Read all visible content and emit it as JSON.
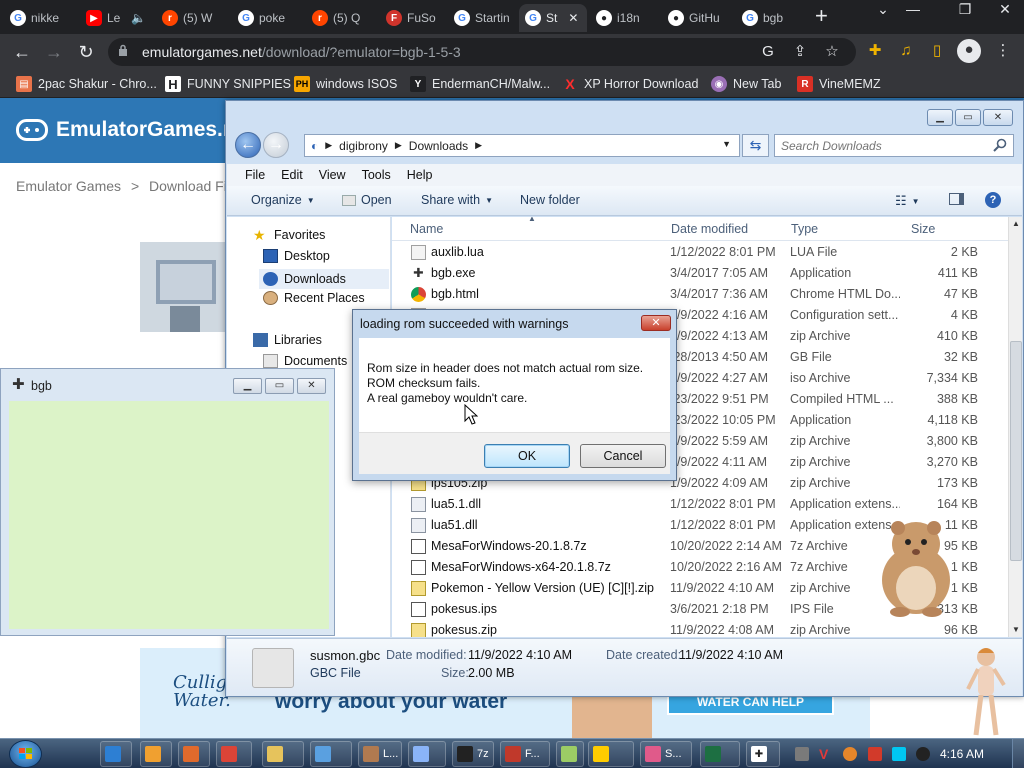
{
  "browser": {
    "tabs": [
      {
        "label": "nikke",
        "favicon": "google-icon",
        "color": "#4285f4"
      },
      {
        "label": "Le",
        "favicon": "youtube-icon",
        "color": "#ff0000"
      },
      {
        "label": "(5) W",
        "favicon": "reddit-icon",
        "color": "#ff4500"
      },
      {
        "label": "poke",
        "favicon": "google-icon",
        "color": "#4285f4"
      },
      {
        "label": "(5) Q",
        "favicon": "reddit-icon",
        "color": "#ff4500"
      },
      {
        "label": "FuSo",
        "favicon": "fuso-icon",
        "color": "#d0342c"
      },
      {
        "label": "Startin",
        "favicon": "google-icon",
        "color": "#4285f4"
      },
      {
        "label": "St",
        "favicon": "google-icon",
        "color": "#4285f4"
      },
      {
        "label": "i18n",
        "favicon": "github-icon",
        "color": "#ffffff"
      },
      {
        "label": "GitHu",
        "favicon": "github-icon",
        "color": "#ffffff"
      },
      {
        "label": "bgb",
        "favicon": "google-icon",
        "color": "#4285f4"
      }
    ],
    "url_host": "emulatorgames.net",
    "url_path": "/download/?emulator=bgb-1-5-3",
    "bookmarks": [
      {
        "label": "2pac Shakur - Chro...",
        "icon": "chrome-store-icon",
        "color": "#e8734a"
      },
      {
        "label": "FUNNY SNIPPIES",
        "icon": "h-icon",
        "color": "#202124",
        "glyph": "H"
      },
      {
        "label": "windows ISOS",
        "icon": "ph-icon",
        "color": "#f7a600",
        "glyph": "PH"
      },
      {
        "label": "EndermanCH/Malw...",
        "icon": "yp-icon",
        "color": "#202124",
        "glyph": "Y"
      },
      {
        "label": "XP Horror Download",
        "icon": "x-icon",
        "color": "#202124",
        "glyph": "X"
      },
      {
        "label": "New Tab",
        "icon": "newtab-icon",
        "color": "#9a6fb5"
      },
      {
        "label": "VineMEMZ",
        "icon": "vine-icon",
        "color": "#d93025",
        "glyph": "R"
      }
    ]
  },
  "website": {
    "logo": "EmulatorGames.ne",
    "breadcrumb_home": "Emulator Games",
    "breadcrumb_sep": ">",
    "breadcrumb_current": "Download Fil",
    "ad_brand": "Culligan",
    "ad_brand_line2": "Water.",
    "ad_text": "worry about your water",
    "ad_cta": "WATER CAN HELP"
  },
  "explorer": {
    "path": [
      "digibrony",
      "Downloads"
    ],
    "search_placeholder": "Search Downloads",
    "menu": [
      "File",
      "Edit",
      "View",
      "Tools",
      "Help"
    ],
    "commands": {
      "organize": "Organize",
      "open": "Open",
      "share": "Share with",
      "new_folder": "New folder"
    },
    "nav": {
      "favorites": "Favorites",
      "desktop": "Desktop",
      "downloads": "Downloads",
      "recent": "Recent Places",
      "libraries": "Libraries",
      "documents": "Documents"
    },
    "columns": {
      "name": "Name",
      "date": "Date modified",
      "type": "Type",
      "size": "Size"
    },
    "files": [
      {
        "name": "auxlib.lua",
        "date": "1/12/2022 8:01 PM",
        "type": "LUA File",
        "size": "2 KB",
        "icon": "file-icon"
      },
      {
        "name": "bgb.exe",
        "date": "3/4/2017 7:05 AM",
        "type": "Application",
        "size": "411 KB",
        "icon": "bgb-exe-icon"
      },
      {
        "name": "bgb.html",
        "date": "3/4/2017 7:36 AM",
        "type": "Chrome HTML Do...",
        "size": "47 KB",
        "icon": "chrome-icon"
      },
      {
        "name": "",
        "date": "1/9/2022 4:16 AM",
        "type": "Configuration sett...",
        "size": "4 KB",
        "icon": "file-icon"
      },
      {
        "name": "",
        "date": "1/9/2022 4:13 AM",
        "type": "zip Archive",
        "size": "410 KB",
        "icon": "file-icon"
      },
      {
        "name": "",
        "date": "/28/2013 4:50 AM",
        "type": "GB File",
        "size": "32 KB",
        "icon": "file-icon"
      },
      {
        "name": "",
        "date": "1/9/2022 4:27 AM",
        "type": "iso Archive",
        "size": "7,334 KB",
        "icon": "file-icon"
      },
      {
        "name": "",
        "date": "/23/2022 9:51 PM",
        "type": "Compiled HTML ...",
        "size": "388 KB",
        "icon": "file-icon"
      },
      {
        "name": "",
        "date": "/23/2022 10:05 PM",
        "type": "Application",
        "size": "4,118 KB",
        "icon": "file-icon"
      },
      {
        "name": "",
        "date": "1/9/2022 5:59 AM",
        "type": "zip Archive",
        "size": "3,800 KB",
        "icon": "file-icon"
      },
      {
        "name": "",
        "date": "1/9/2022 4:11 AM",
        "type": "zip Archive",
        "size": "3,270 KB",
        "icon": "file-icon"
      },
      {
        "name": "ips105.zip",
        "date": "1/9/2022 4:09 AM",
        "type": "zip Archive",
        "size": "173 KB",
        "icon": "zip-icon"
      },
      {
        "name": "lua5.1.dll",
        "date": "1/12/2022 8:01 PM",
        "type": "Application extens...",
        "size": "164 KB",
        "icon": "dll-icon"
      },
      {
        "name": "lua51.dll",
        "date": "1/12/2022 8:01 PM",
        "type": "Application extens...",
        "size": "11 KB",
        "icon": "dll-icon"
      },
      {
        "name": "MesaForWindows-20.1.8.7z",
        "date": "10/20/2022 2:14 AM",
        "type": "7z Archive",
        "size": "95 KB",
        "icon": "7z-icon"
      },
      {
        "name": "MesaForWindows-x64-20.1.8.7z",
        "date": "10/20/2022 2:16 AM",
        "type": "7z Archive",
        "size": "1 KB",
        "icon": "7z-icon"
      },
      {
        "name": "Pokemon - Yellow Version (UE) [C][!].zip",
        "date": "11/9/2022 4:10 AM",
        "type": "zip Archive",
        "size": "1 KB",
        "icon": "zip-icon"
      },
      {
        "name": "pokesus.ips",
        "date": "3/6/2021 2:18 PM",
        "type": "IPS File",
        "size": "313 KB",
        "icon": "ips-icon"
      },
      {
        "name": "pokesus.zip",
        "date": "11/9/2022 4:08 AM",
        "type": "zip Archive",
        "size": "96 KB",
        "icon": "zip-icon"
      }
    ],
    "details": {
      "name": "susmon.gbc",
      "type": "GBC File",
      "modified_label": "Date modified:",
      "modified": "11/9/2022 4:10 AM",
      "created_label": "Date created:",
      "created": "11/9/2022 4:10 AM",
      "size_label": "Size:",
      "size": "2.00 MB"
    }
  },
  "bgb_window": {
    "title": "bgb",
    "screen_color": "#dcf3c8"
  },
  "dialog": {
    "title": "loading rom succeeded with warnings",
    "line1": "Rom size in header does not match actual rom size.",
    "line2": "ROM checksum fails.",
    "line3": "A real gameboy wouldn't care.",
    "ok": "OK",
    "cancel": "Cancel"
  },
  "taskbar": {
    "items": [
      {
        "label": "",
        "icon": "ie-icon",
        "color": "#2d7fd3"
      },
      {
        "label": "",
        "icon": "media-icon",
        "color": "#f0a030"
      },
      {
        "label": "",
        "icon": "paint-icon",
        "color": "#e06a2c"
      },
      {
        "label": "",
        "icon": "chrome-icon",
        "color": "#db4437"
      },
      {
        "label": "",
        "icon": "folder-icon",
        "color": "#e6c35c"
      },
      {
        "label": "",
        "icon": "window-icon",
        "color": "#5aa0e0"
      },
      {
        "label": "L...",
        "icon": "app-l-icon",
        "color": "#b07a50"
      },
      {
        "label": "",
        "icon": "doc-icon",
        "color": "#8ab4f8"
      },
      {
        "label": "7z",
        "icon": "7z-icon",
        "color": "#222222"
      },
      {
        "label": "F...",
        "icon": "app-f-icon",
        "color": "#c0392b"
      },
      {
        "label": "",
        "icon": "notepad-icon",
        "color": "#9ccc65"
      },
      {
        "label": "",
        "icon": "xbox-icon",
        "color": "#ffcc00"
      },
      {
        "label": "S...",
        "icon": "app-s-icon",
        "color": "#e05a8a"
      },
      {
        "label": "",
        "icon": "excel-icon",
        "color": "#1d6f42"
      },
      {
        "label": "",
        "icon": "bgb-icon",
        "color": "#ffffff"
      }
    ],
    "clock": "4:16 AM"
  }
}
